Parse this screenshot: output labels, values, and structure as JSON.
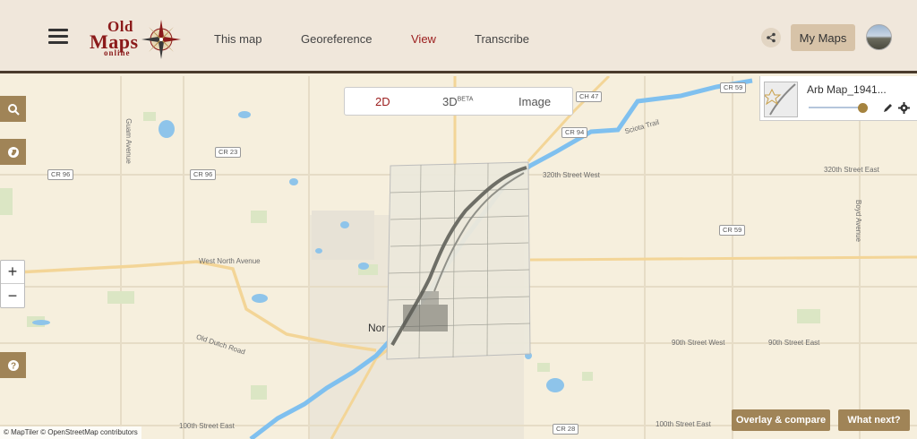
{
  "logo": {
    "line1": "Old",
    "line2": "Maps",
    "line3": "online"
  },
  "nav": {
    "this_map": "This map",
    "georeference": "Georeference",
    "view": "View",
    "transcribe": "Transcribe"
  },
  "header_right": {
    "my_maps": "My Maps"
  },
  "view_switch": {
    "2d": "2D",
    "3d": "3D",
    "beta": "BETA",
    "image": "Image"
  },
  "layer": {
    "name": "Arb Map_1941...",
    "opacity": 0.9
  },
  "map_labels": {
    "guam": "Guam Avenue",
    "west_north": "West North Avenue",
    "old_dutch": "Old Dutch Road",
    "sciota": "Sciota Trail",
    "st320w": "320th Street West",
    "st320e": "320th Street East",
    "boyd": "Boyd Avenue",
    "st90w": "90th Street West",
    "st90e": "90th Street East",
    "st90e2": "90th Street East",
    "st100e": "100th Street East",
    "st100e2": "100th Street East",
    "city": "Nor"
  },
  "shields": {
    "cr96a": "CR 96",
    "cr96b": "CR 96",
    "cr23": "CR 23",
    "ch47": "CH 47",
    "cr94": "CR 94",
    "cr59a": "CR 59",
    "cr59b": "CR 59",
    "cr28": "CR 28"
  },
  "buttons": {
    "overlay": "Overlay & compare",
    "what_next": "What next?",
    "zoom_in": "+",
    "zoom_out": "−"
  },
  "attribution": "© MapTiler © OpenStreetMap contributors",
  "colors": {
    "accent": "#9b1c1c",
    "tool_bg": "#a08457",
    "header_bg": "#f0e7db"
  }
}
